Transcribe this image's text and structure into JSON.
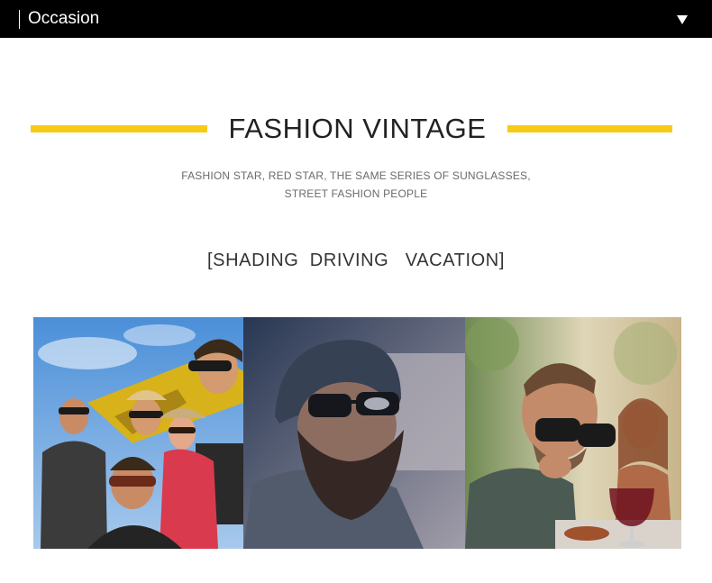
{
  "header": {
    "title": "Occasion",
    "dropdown_icon": "triangle-down-icon",
    "background": "#000000",
    "text_color": "#ffffff"
  },
  "section": {
    "headline": "FASHION VINTAGE",
    "subtitle_line1": "FASHION STAR, RED STAR, THE SAME SERIES OF SUNGLASSES,",
    "subtitle_line2": "STREET FASHION PEOPLE",
    "occasions_line": "[SHADING  DRIVING   VACATION]",
    "accent_color": "#f7cb14"
  },
  "photos": [
    {
      "name": "group-of-friends-with-sunglasses-photo"
    },
    {
      "name": "bearded-man-in-beanie-driving-photo"
    },
    {
      "name": "man-with-sunglasses-eating-vacation-photo"
    }
  ]
}
